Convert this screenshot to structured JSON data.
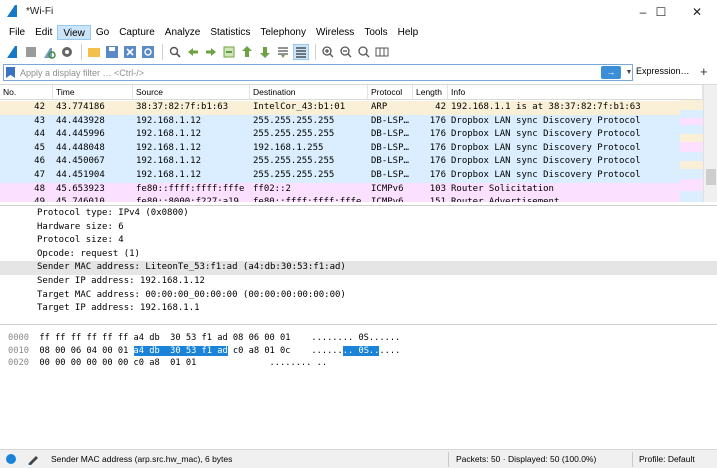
{
  "window": {
    "title": "*Wi-Fi",
    "minimize": "–",
    "maximize": "☐",
    "close": "✕"
  },
  "menu": [
    "File",
    "Edit",
    "View",
    "Go",
    "Capture",
    "Analyze",
    "Statistics",
    "Telephony",
    "Wireless",
    "Tools",
    "Help"
  ],
  "menu_active": "View",
  "filter": {
    "placeholder": "Apply a display filter … <Ctrl-/>",
    "apply_arrow": "→",
    "dropdown": "▼",
    "expression": "Expression…",
    "add": "+"
  },
  "packet_list": {
    "columns": [
      "No.",
      "Time",
      "Source",
      "Destination",
      "Protocol",
      "Length",
      "Info"
    ],
    "rows": [
      {
        "no": "42",
        "time": "43.774186",
        "source": "38:37:82:7f:b1:63",
        "destination": "IntelCor_43:b1:01",
        "protocol": "ARP",
        "length": "42",
        "info": "192.168.1.1 is at 38:37:82:7f:b1:63",
        "bg": "#faf0d7"
      },
      {
        "no": "43",
        "time": "44.443928",
        "source": "192.168.1.12",
        "destination": "255.255.255.255",
        "protocol": "DB-LSP…",
        "length": "176",
        "info": "Dropbox LAN sync Discovery Protocol",
        "bg": "#daeeff"
      },
      {
        "no": "44",
        "time": "44.445996",
        "source": "192.168.1.12",
        "destination": "255.255.255.255",
        "protocol": "DB-LSP…",
        "length": "176",
        "info": "Dropbox LAN sync Discovery Protocol",
        "bg": "#daeeff"
      },
      {
        "no": "45",
        "time": "44.448048",
        "source": "192.168.1.12",
        "destination": "192.168.1.255",
        "protocol": "DB-LSP…",
        "length": "176",
        "info": "Dropbox LAN sync Discovery Protocol",
        "bg": "#daeeff"
      },
      {
        "no": "46",
        "time": "44.450067",
        "source": "192.168.1.12",
        "destination": "255.255.255.255",
        "protocol": "DB-LSP…",
        "length": "176",
        "info": "Dropbox LAN sync Discovery Protocol",
        "bg": "#daeeff"
      },
      {
        "no": "47",
        "time": "44.451904",
        "source": "192.168.1.12",
        "destination": "255.255.255.255",
        "protocol": "DB-LSP…",
        "length": "176",
        "info": "Dropbox LAN sync Discovery Protocol",
        "bg": "#daeeff"
      },
      {
        "no": "48",
        "time": "45.653923",
        "source": "fe80::ffff:ffff:fffe",
        "destination": "ff02::2",
        "protocol": "ICMPv6",
        "length": "103",
        "info": "Router Solicitation",
        "bg": "#fce0ff"
      },
      {
        "no": "49",
        "time": "45.746010",
        "source": "fe80::8000:f227:a19",
        "destination": "fe80::ffff:ffff:fffe",
        "protocol": "ICMPv6",
        "length": "151",
        "info": "Router Advertisement",
        "bg": "#fce0ff"
      }
    ]
  },
  "details": [
    "Protocol type: IPv4 (0x0800)",
    "Hardware size: 6",
    "Protocol size: 4",
    "Opcode: request (1)",
    "Sender MAC address: LiteonTe_53:f1:ad (a4:db:30:53:f1:ad)",
    "Sender IP address: 192.168.1.12",
    "Target MAC address: 00:00:00_00:00:00 (00:00:00:00:00:00)",
    "Target IP address: 192.168.1.1"
  ],
  "bytes": [
    {
      "offset": "0000",
      "hex_pre": "ff ff ff ff ff ff a4 db  30 53 f1 ad 08 06 00 01",
      "hex_sel": "",
      "hex_post": "",
      "ascii_pre": "........ 0S......",
      "ascii_sel": "",
      "ascii_post": ""
    },
    {
      "offset": "0010",
      "hex_pre": "08 00 06 04 00 01 ",
      "hex_sel": "a4 db  30 53 f1 ad",
      "hex_post": " c0 a8 01 0c",
      "ascii_pre": "......",
      "ascii_sel": ".. 0S..",
      "ascii_post": "...."
    },
    {
      "offset": "0020",
      "hex_pre": "00 00 00 00 00 00 c0 a8  01 01",
      "hex_sel": "",
      "hex_post": "",
      "ascii_pre": "........ ..",
      "ascii_sel": "",
      "ascii_post": ""
    }
  ],
  "status": {
    "field": "Sender MAC address (arp.src.hw_mac), 6 bytes",
    "packets": "Packets: 50 · Displayed: 50 (100.0%)",
    "profile": "Profile: Default"
  }
}
